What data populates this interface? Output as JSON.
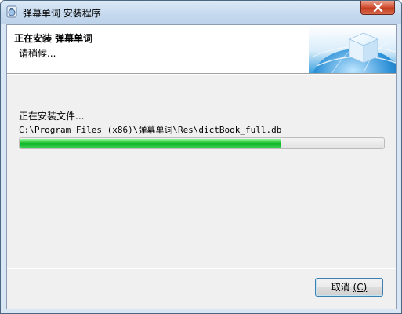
{
  "window": {
    "title": "弹幕单词 安装程序",
    "icon": "installer-app-icon",
    "close_icon": "close-icon"
  },
  "header": {
    "title": "正在安装 弹幕单词",
    "subtitle": "请稍候..."
  },
  "progress": {
    "status": "正在安装文件...",
    "current_file": "C:\\Program Files (x86)\\弹幕单词\\Res\\dictBook_full.db",
    "percent": 72,
    "fill_color": "#06b025"
  },
  "buttons": {
    "cancel_label": "取消",
    "cancel_mnemonic": "(C)"
  }
}
